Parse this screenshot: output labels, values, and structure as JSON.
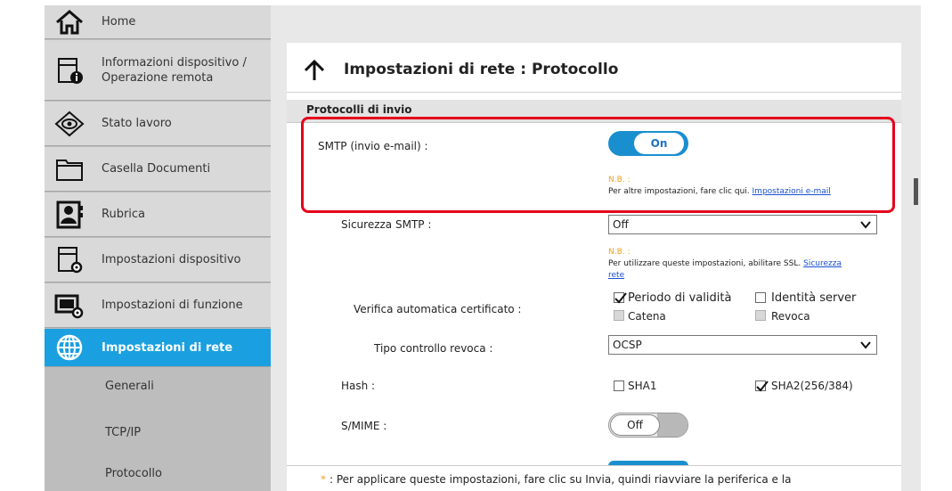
{
  "sidebar": {
    "items": [
      {
        "label": "Home",
        "icon": "home-icon"
      },
      {
        "label": "Informazioni dispositivo / Operazione remota",
        "icon": "device-info-icon"
      },
      {
        "label": "Stato lavoro",
        "icon": "eye-icon"
      },
      {
        "label": "Casella Documenti",
        "icon": "folder-icon"
      },
      {
        "label": "Rubrica",
        "icon": "address-book-icon"
      },
      {
        "label": "Impostazioni dispositivo",
        "icon": "device-settings-icon"
      },
      {
        "label": "Impostazioni di funzione",
        "icon": "function-settings-icon"
      },
      {
        "label": "Impostazioni di rete",
        "icon": "globe-icon"
      }
    ],
    "sub_items": [
      "Generali",
      "TCP/IP",
      "Protocollo"
    ]
  },
  "page": {
    "title": "Impostazioni di rete : Protocollo",
    "section": "Protocolli di invio"
  },
  "smtp": {
    "label": "SMTP (invio e-mail) :",
    "toggle": "On",
    "note_label": "N.B. :",
    "note_text": "Per altre impostazioni, fare clic qui.",
    "note_link": "Impostazioni e-mail"
  },
  "smtp_security": {
    "label": "Sicurezza SMTP :",
    "value": "Off",
    "note_label": "N.B. :",
    "note_text": "Per utilizzare queste impostazioni, abilitare SSL.",
    "note_link_1": "Sicurezza",
    "note_link_2": "rete"
  },
  "cert_check": {
    "label": "Verifica automatica certificato :",
    "options": [
      {
        "label": "Periodo di validità",
        "checked": true,
        "disabled": false
      },
      {
        "label": "Identità server",
        "checked": false,
        "disabled": false
      },
      {
        "label": "Catena",
        "checked": false,
        "disabled": true
      },
      {
        "label": "Revoca",
        "checked": false,
        "disabled": true
      }
    ]
  },
  "revocation": {
    "label": "Tipo controllo revoca :",
    "value": "OCSP"
  },
  "hash": {
    "label": "Hash :",
    "options": [
      {
        "label": "SHA1",
        "checked": false
      },
      {
        "label": "SHA2(256/384)",
        "checked": true
      }
    ]
  },
  "smime": {
    "label": "S/MIME :",
    "toggle": "Off"
  },
  "footer": {
    "star": "*",
    "text": ": Per applicare queste impostazioni, fare clic su Invia, quindi riavviare la periferica e la"
  },
  "colors": {
    "accent": "#1aa0e0",
    "highlight": "#e3001b",
    "note": "#f0a020",
    "link": "#1a4fd0"
  }
}
